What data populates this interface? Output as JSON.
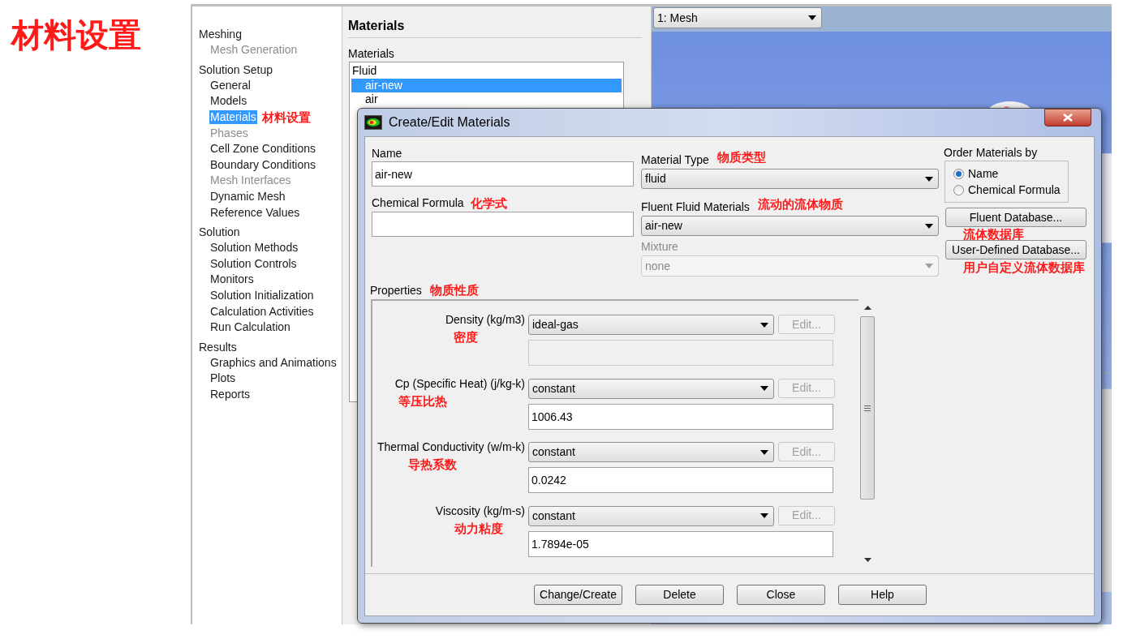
{
  "slide_title": "材料设置",
  "tree": [
    {
      "label": "Meshing",
      "children": [
        {
          "label": "Mesh Generation",
          "disabled": true,
          "selected": false
        }
      ]
    },
    {
      "label": "Solution Setup",
      "children": [
        {
          "label": "General",
          "disabled": false,
          "selected": false
        },
        {
          "label": "Models",
          "disabled": false,
          "selected": false
        },
        {
          "label": "Materials",
          "disabled": false,
          "selected": true,
          "note": "材料设置"
        },
        {
          "label": "Phases",
          "disabled": true,
          "selected": false
        },
        {
          "label": "Cell Zone Conditions",
          "disabled": false,
          "selected": false
        },
        {
          "label": "Boundary Conditions",
          "disabled": false,
          "selected": false
        },
        {
          "label": "Mesh Interfaces",
          "disabled": true,
          "selected": false
        },
        {
          "label": "Dynamic Mesh",
          "disabled": false,
          "selected": false
        },
        {
          "label": "Reference Values",
          "disabled": false,
          "selected": false
        }
      ]
    },
    {
      "label": "Solution",
      "children": [
        {
          "label": "Solution Methods",
          "disabled": false,
          "selected": false
        },
        {
          "label": "Solution Controls",
          "disabled": false,
          "selected": false
        },
        {
          "label": "Monitors",
          "disabled": false,
          "selected": false
        },
        {
          "label": "Solution Initialization",
          "disabled": false,
          "selected": false
        },
        {
          "label": "Calculation Activities",
          "disabled": false,
          "selected": false
        },
        {
          "label": "Run Calculation",
          "disabled": false,
          "selected": false
        }
      ]
    },
    {
      "label": "Results",
      "children": [
        {
          "label": "Graphics and Animations",
          "disabled": false,
          "selected": false
        },
        {
          "label": "Plots",
          "disabled": false,
          "selected": false
        },
        {
          "label": "Reports",
          "disabled": false,
          "selected": false
        }
      ]
    }
  ],
  "materials_panel": {
    "title": "Materials",
    "list_label": "Materials",
    "list": [
      {
        "label": "Fluid",
        "kind": "group",
        "selected": false
      },
      {
        "label": "air-new",
        "kind": "item",
        "selected": true
      },
      {
        "label": "air",
        "kind": "item",
        "selected": false
      }
    ]
  },
  "graphics": {
    "view_selector": "1: Mesh"
  },
  "dialog": {
    "title": "Create/Edit Materials",
    "name": {
      "label": "Name",
      "value": "air-new"
    },
    "chemical_formula": {
      "label": "Chemical Formula",
      "note": "化学式"
    },
    "material_type": {
      "label": "Material Type",
      "note": "物质类型",
      "value": "fluid",
      "disabled": false
    },
    "fluent_materials": {
      "label": "Fluent Fluid Materials",
      "note": "流动的流体物质",
      "value": "air-new",
      "disabled": false
    },
    "mixture": {
      "label": "Mixture",
      "value": "none",
      "disabled": true
    },
    "order_by": {
      "label": "Order Materials by",
      "options": [
        {
          "label": "Name",
          "selected": true
        },
        {
          "label": "Chemical Formula",
          "selected": false
        }
      ]
    },
    "database_buttons": [
      {
        "label": "Fluent Database...",
        "note": "流体数据库"
      },
      {
        "label": "User-Defined Database...",
        "note": "用户自定义流体数据库"
      }
    ],
    "properties": {
      "label": "Properties",
      "note": "物质性质",
      "rows": [
        {
          "label": "Density (kg/m3)",
          "note": "密度",
          "method": "ideal-gas",
          "edit": "Edit...",
          "edit_disabled": true,
          "field_disabled": true
        },
        {
          "label": "Cp (Specific Heat) (j/kg-k)",
          "note": "等压比热",
          "method": "constant",
          "edit": "Edit...",
          "edit_disabled": true,
          "field_disabled": false,
          "value": "1006.43"
        },
        {
          "label": "Thermal Conductivity (w/m-k)",
          "note": "导热系数",
          "method": "constant",
          "edit": "Edit...",
          "edit_disabled": true,
          "field_disabled": false,
          "value": "0.0242"
        },
        {
          "label": "Viscosity (kg/m-s)",
          "note": "动力粘度",
          "method": "constant",
          "edit": "Edit...",
          "edit_disabled": true,
          "field_disabled": false,
          "value": "1.7894e-05"
        }
      ]
    },
    "buttons": [
      "Change/Create",
      "Delete",
      "Close",
      "Help"
    ]
  }
}
